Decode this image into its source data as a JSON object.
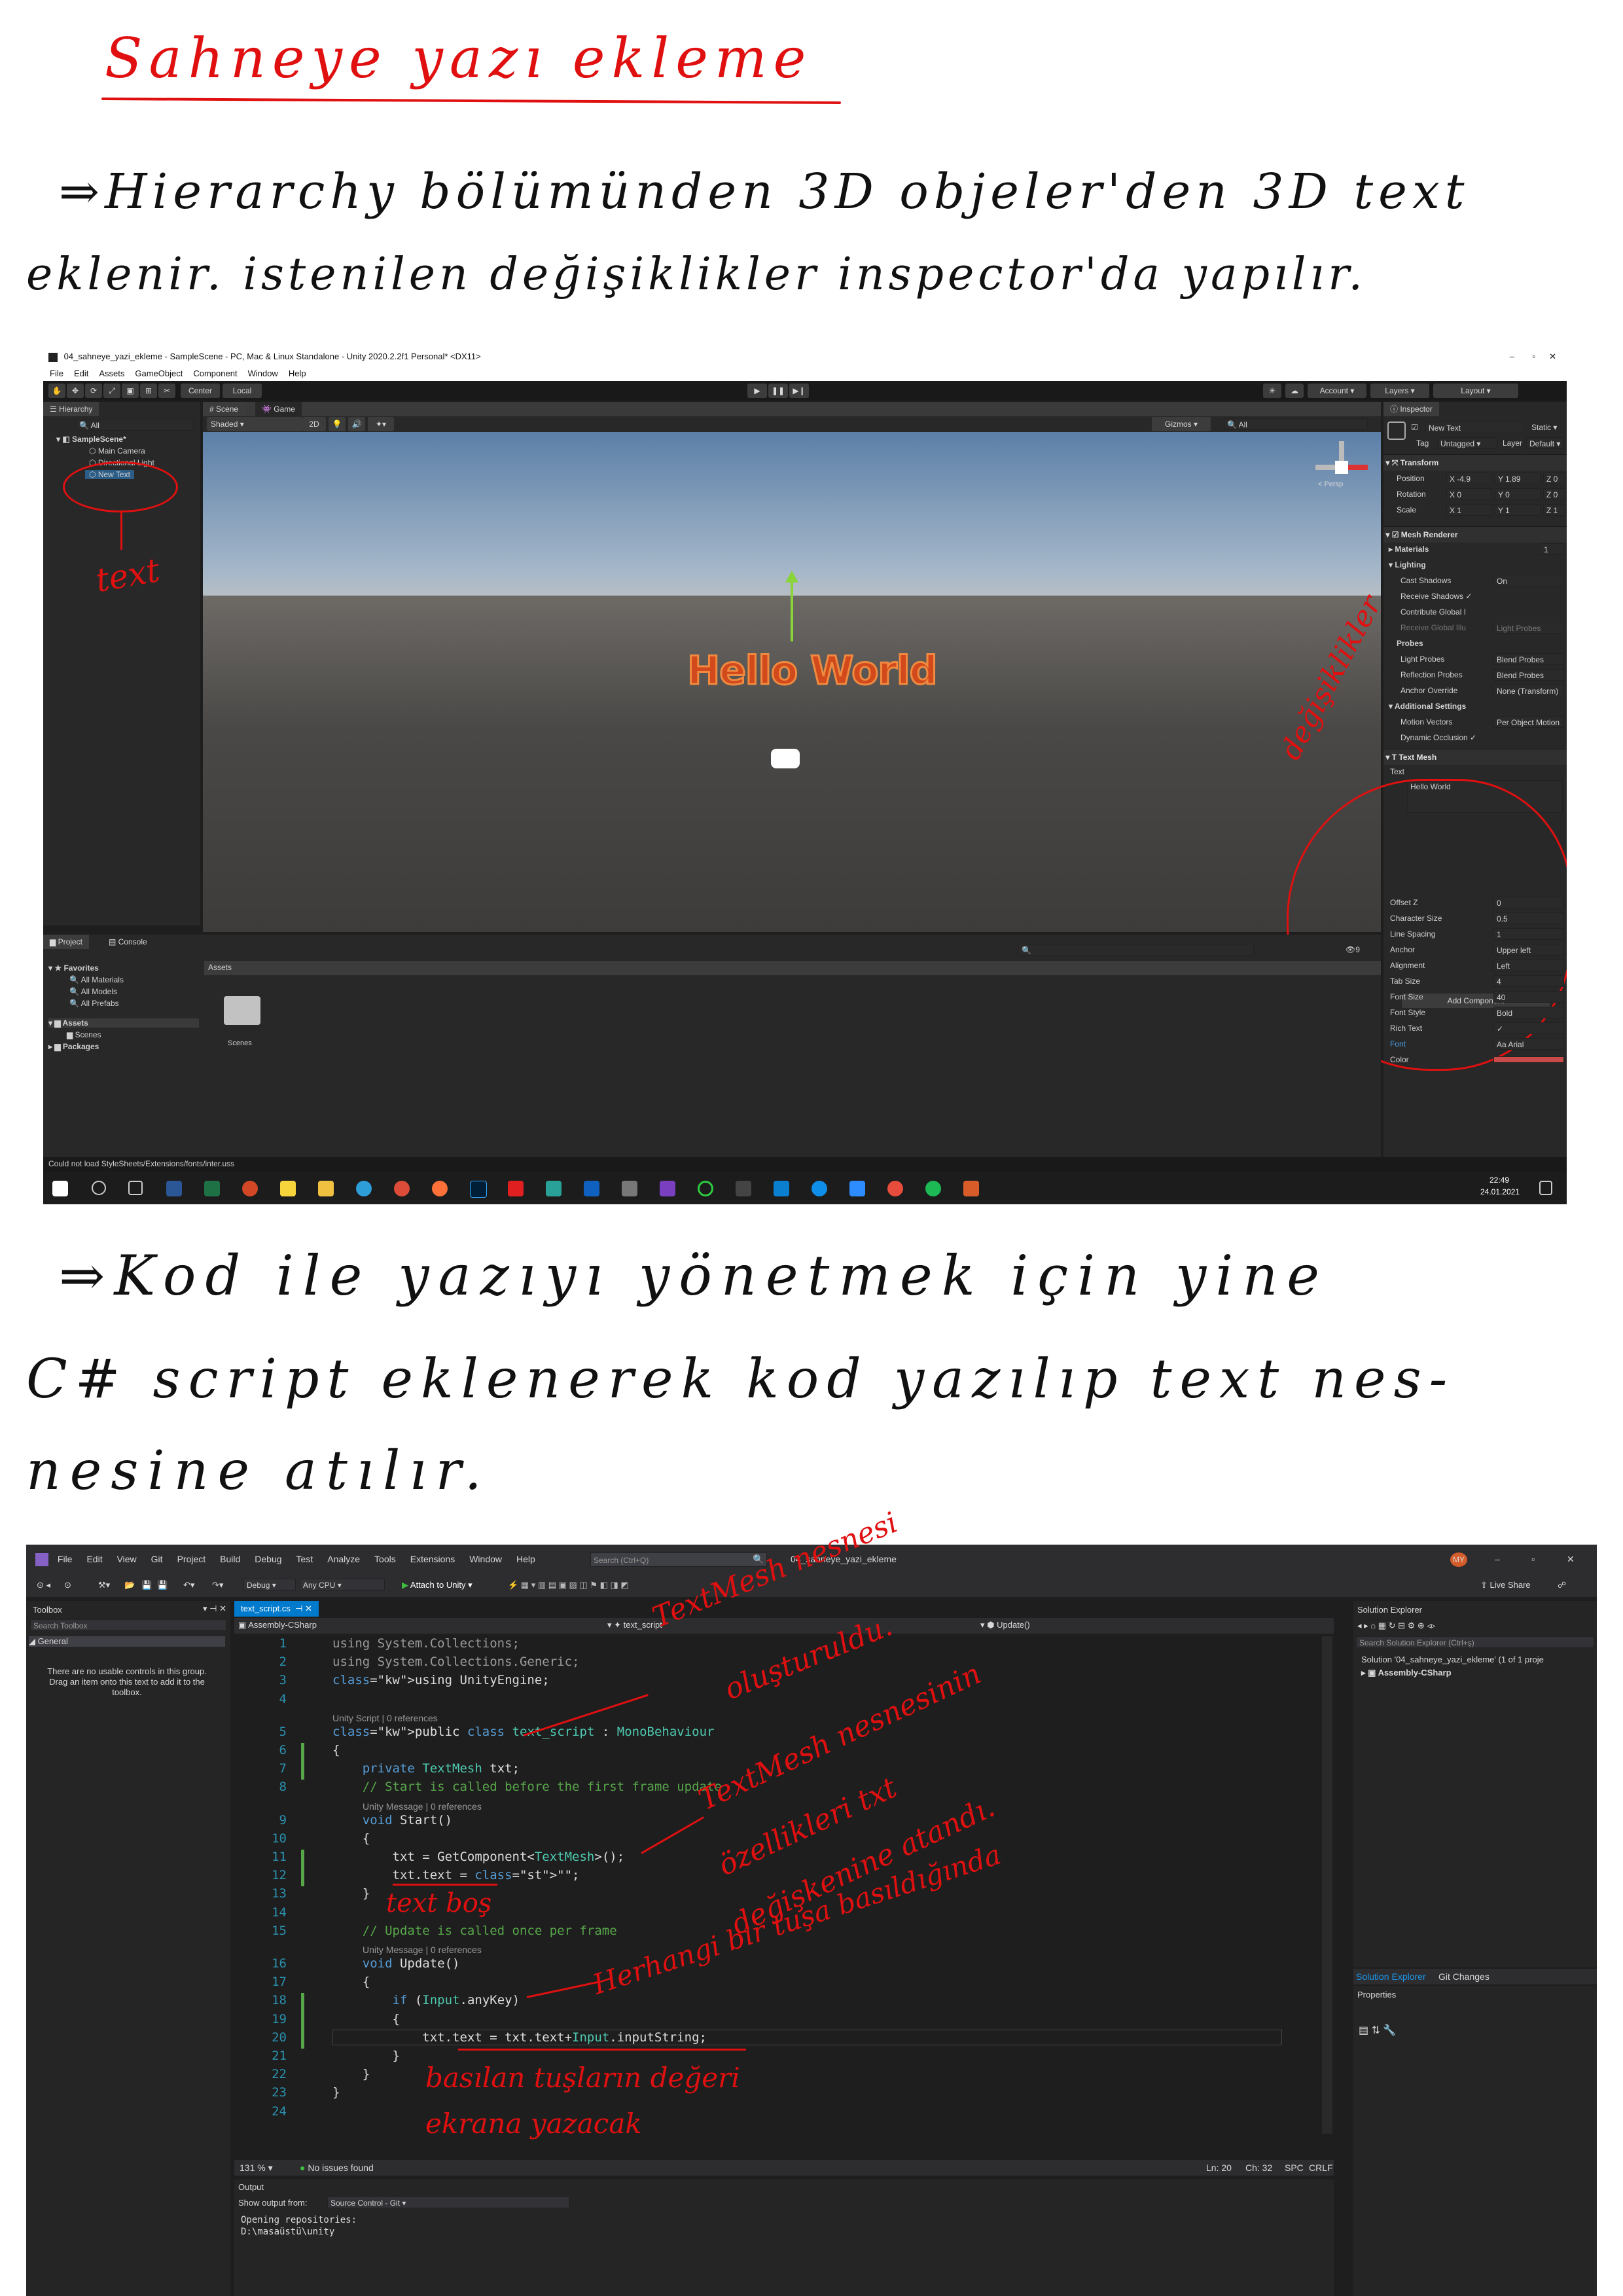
{
  "notes": {
    "title": "Sahneye yazı ekleme",
    "para1_line1": "⇒Hierarchy bölümünden 3D objeler'den 3D text",
    "para1_line2": "eklenir. istenilen değişiklikler inspector'da yapılır.",
    "para2_line1": "⇒Kod ile yazıyı yönetmek için yine",
    "para2_line2": "C# script eklenerek kod yazılıp text nes-",
    "para2_line3": "nesine atılır."
  },
  "unity": {
    "window_title": "04_sahneye_yazi_ekleme - SampleScene - PC, Mac & Linux Standalone - Unity 2020.2.2f1 Personal* <DX11>",
    "menu": [
      "File",
      "Edit",
      "Assets",
      "GameObject",
      "Component",
      "Window",
      "Help"
    ],
    "toolbar": {
      "center": "Center",
      "local": "Local",
      "account": "Account",
      "layers": "Layers",
      "layout": "Layout"
    },
    "hierarchy": {
      "tab": "Hierarchy",
      "search": "All",
      "scene": "SampleScene*",
      "items": [
        "Main Camera",
        "Directional Light",
        "New Text"
      ]
    },
    "scene": {
      "tab_scene": "Scene",
      "tab_game": "Game",
      "shading": "Shaded",
      "mode_2d": "2D",
      "gizmos": "Gizmos",
      "search": "All",
      "persp": "< Persp",
      "text_3d": "Hello World"
    },
    "inspector": {
      "tab": "Inspector",
      "object_name": "New Text",
      "static": "Static",
      "tag_label": "Tag",
      "tag": "Untagged",
      "layer_label": "Layer",
      "layer": "Default",
      "transform": {
        "title": "Transform",
        "position": {
          "label": "Position",
          "x": "-4.9",
          "y": "1.89",
          "z": "0"
        },
        "rotation": {
          "label": "Rotation",
          "x": "0",
          "y": "0",
          "z": "0"
        },
        "scale": {
          "label": "Scale",
          "x": "1",
          "y": "1",
          "z": "1"
        }
      },
      "mesh_renderer": {
        "title": "Mesh Renderer",
        "materials": "Materials",
        "materials_count": "1",
        "lighting": "Lighting",
        "cast_shadows": "Cast Shadows",
        "cast_shadows_val": "On",
        "receive_shadows": "Receive Shadows",
        "contribute_gi": "Contribute Global I",
        "receive_gi": "Receive Global Illu",
        "receive_gi_val": "Light Probes",
        "probes": "Probes",
        "light_probes": "Light Probes",
        "light_probes_val": "Blend Probes",
        "reflection_probes": "Reflection Probes",
        "reflection_probes_val": "Blend Probes",
        "anchor_override": "Anchor Override",
        "anchor_override_val": "None (Transform)",
        "additional": "Additional Settings",
        "motion_vectors": "Motion Vectors",
        "motion_vectors_val": "Per Object Motion",
        "dynamic_occlusion": "Dynamic Occlusion"
      },
      "text_mesh": {
        "title": "Text Mesh",
        "text_label": "Text",
        "text_value": "Hello World",
        "rows": [
          {
            "label": "Offset Z",
            "value": "0"
          },
          {
            "label": "Character Size",
            "value": "0.5"
          },
          {
            "label": "Line Spacing",
            "value": "1"
          },
          {
            "label": "Anchor",
            "value": "Upper left"
          },
          {
            "label": "Alignment",
            "value": "Left"
          },
          {
            "label": "Tab Size",
            "value": "4"
          },
          {
            "label": "Font Size",
            "value": "40"
          },
          {
            "label": "Font Style",
            "value": "Bold"
          },
          {
            "label": "Rich Text",
            "value": "✓"
          },
          {
            "label": "Font",
            "value": "Aa Arial"
          },
          {
            "label": "Color",
            "value": ""
          }
        ]
      },
      "add_component": "Add Component"
    },
    "project": {
      "tab_project": "Project",
      "tab_console": "Console",
      "favorites": "Favorites",
      "fav_items": [
        "All Materials",
        "All Models",
        "All Prefabs"
      ],
      "assets": "Assets",
      "asset_children": [
        "Scenes"
      ],
      "packages": "Packages",
      "breadcrumb": "Assets",
      "folder": "Scenes",
      "count": "9"
    },
    "status": "Could not load StyleSheets/Extensions/fonts/inter.uss",
    "clock_time": "22:49",
    "clock_date": "24.01.2021",
    "annotations": {
      "text": "text",
      "degisiklikler": "değişiklikler"
    }
  },
  "vs": {
    "menu": [
      "File",
      "Edit",
      "View",
      "Git",
      "Project",
      "Build",
      "Debug",
      "Test",
      "Analyze",
      "Tools",
      "Extensions",
      "Window",
      "Help"
    ],
    "search_placeholder": "Search (Ctrl+Q)",
    "solution_name": "04_sahneye_yazi_ekleme",
    "avatar": "MY",
    "live_share": "Live Share",
    "config": "Debug",
    "platform": "Any CPU",
    "attach": "Attach to Unity",
    "toolbox": {
      "title": "Toolbox",
      "search": "Search Toolbox",
      "group": "General",
      "empty": "There are no usable controls in this group. Drag an item onto this text to add it to the toolbox."
    },
    "editor": {
      "tab": "text_script.cs",
      "nav_project": "Assembly-CSharp",
      "nav_class": "text_script",
      "nav_member": "Update()",
      "lines": [
        {
          "n": "1",
          "text": "using System.Collections;"
        },
        {
          "n": "2",
          "text": "using System.Collections.Generic;"
        },
        {
          "n": "3",
          "text": "using UnityEngine;"
        },
        {
          "n": "4",
          "text": ""
        },
        {
          "n": "5",
          "text": "public class text_script : MonoBehaviour"
        },
        {
          "n": "6",
          "text": "{"
        },
        {
          "n": "7",
          "text": "    private TextMesh txt;"
        },
        {
          "n": "8",
          "text": "    // Start is called before the first frame update"
        },
        {
          "n": "9",
          "text": "    void Start()"
        },
        {
          "n": "10",
          "text": "    {"
        },
        {
          "n": "11",
          "text": "        txt = GetComponent<TextMesh>();"
        },
        {
          "n": "12",
          "text": "        txt.text = \"\";"
        },
        {
          "n": "13",
          "text": "    }"
        },
        {
          "n": "14",
          "text": ""
        },
        {
          "n": "15",
          "text": "    // Update is called once per frame"
        },
        {
          "n": "16",
          "text": "    void Update()"
        },
        {
          "n": "17",
          "text": "    {"
        },
        {
          "n": "18",
          "text": "        if (Input.anyKey)"
        },
        {
          "n": "19",
          "text": "        {"
        },
        {
          "n": "20",
          "text": "            txt.text = txt.text+Input.inputString;"
        },
        {
          "n": "21",
          "text": "        }"
        },
        {
          "n": "22",
          "text": "    }"
        },
        {
          "n": "23",
          "text": "}"
        },
        {
          "n": "24",
          "text": ""
        }
      ],
      "hint_class": "Unity Script | 0 references",
      "hint_start": "Unity Message | 0 references",
      "hint_update": "Unity Message | 0 references",
      "zoom": "131 %",
      "issues": "No issues found",
      "ln": "Ln: 20",
      "ch": "Ch: 32",
      "spc": "SPC",
      "crlf": "CRLF"
    },
    "output": {
      "title": "Output",
      "from_label": "Show output from:",
      "from_value": "Source Control - Git",
      "line1": "Opening repositories:",
      "line2": "D:\\masaüstü\\unity"
    },
    "solution_explorer": {
      "title": "Solution Explorer",
      "search": "Search Solution Explorer (Ctrl+ş)",
      "solution": "Solution '04_sahneye_yazi_ekleme' (1 of 1 proje",
      "project": "Assembly-CSharp",
      "tab1": "Solution Explorer",
      "tab2": "Git Changes"
    },
    "properties": {
      "title": "Properties"
    },
    "annotations": {
      "a1_line1": "TextMesh nesnesi",
      "a1_line2": "oluşturuldu.",
      "a2_line1": "TextMesh nesnesinin",
      "a2_line2": "özellikleri txt",
      "a2_line3": "değişkenine atandı.",
      "a3": "text boş",
      "a4": "Herhangi bir tuşa basıldığında",
      "a5_line1": "basılan tuşların değeri",
      "a5_line2": "ekrana yazacak"
    }
  }
}
